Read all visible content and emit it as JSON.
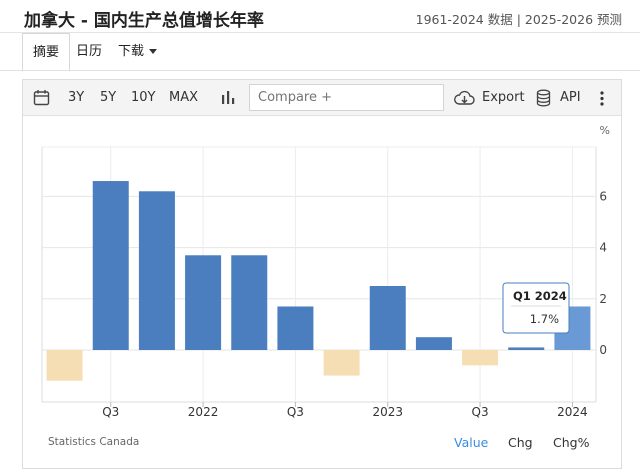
{
  "header": {
    "title": "加拿大 - 国内生产总值增长年率",
    "subtitle": "1961-2024 数据 | 2025-2026 预测"
  },
  "tabs": [
    {
      "label": "摘要"
    },
    {
      "label": "日历"
    },
    {
      "label": "下载"
    }
  ],
  "toolbar": {
    "ranges": [
      "3Y",
      "5Y",
      "10Y",
      "MAX"
    ],
    "compare_placeholder": "Compare +",
    "export_label": "Export",
    "api_label": "API",
    "icons": [
      "calendar-icon",
      "bar-chart-icon",
      "cloud-download-icon",
      "database-icon",
      "more-vertical-icon"
    ]
  },
  "footer": {
    "source": "Statistics Canada",
    "views": [
      "Value",
      "Chg",
      "Chg%"
    ]
  },
  "colors": {
    "positive": "#4a7ebf",
    "negative": "#f5deb3",
    "highlight": "#6a9ad6",
    "accent_link": "#3a8dde"
  },
  "chart_data": {
    "type": "bar",
    "unit": "%",
    "categories": [
      "2021 Q2",
      "2021 Q3",
      "2021 Q4",
      "2022 Q1",
      "2022 Q2",
      "2022 Q3",
      "2022 Q4",
      "2023 Q1",
      "2023 Q2",
      "2023 Q3",
      "2023 Q4",
      "2024 Q1"
    ],
    "values": [
      -1.2,
      6.6,
      6.2,
      3.7,
      3.7,
      1.7,
      -1.0,
      2.5,
      0.5,
      -0.6,
      0.1,
      1.7
    ],
    "x_tick_labels": [
      "Q3",
      "2022",
      "Q3",
      "2023",
      "Q3",
      "2024"
    ],
    "y_ticks": [
      0,
      2,
      4,
      6
    ],
    "ylim": [
      -2.1,
      8
    ],
    "grid": true,
    "tooltip": {
      "title": "Q1 2024",
      "value": "1.7%"
    }
  }
}
